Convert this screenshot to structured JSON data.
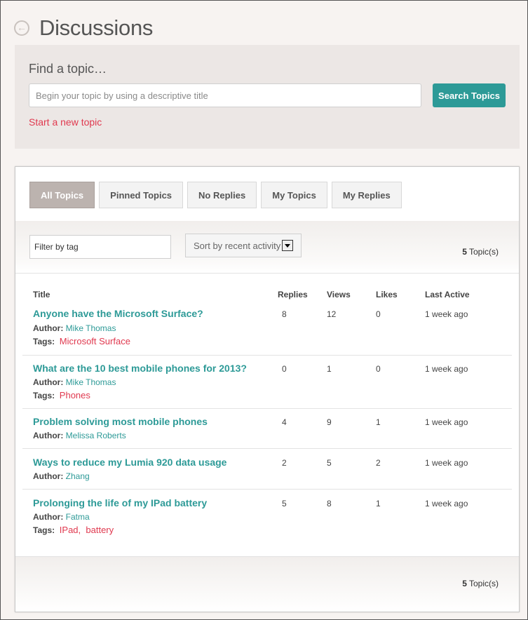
{
  "header": {
    "title": "Discussions",
    "back_icon": "arrow-left-circle-icon"
  },
  "search": {
    "label": "Find a topic…",
    "placeholder": "Begin your topic by using a descriptive title",
    "button_label": "Search Topics",
    "new_topic_label": "Start a new topic"
  },
  "tabs": [
    {
      "label": "All Topics",
      "active": true
    },
    {
      "label": "Pinned Topics",
      "active": false
    },
    {
      "label": "No Replies",
      "active": false
    },
    {
      "label": "My Topics",
      "active": false
    },
    {
      "label": "My Replies",
      "active": false
    }
  ],
  "filters": {
    "tag_placeholder": "Filter by tag",
    "sort_selected": "Sort by recent activity",
    "count_number": "5",
    "count_label": " Topic(s)"
  },
  "columns": {
    "title": "Title",
    "replies": "Replies",
    "views": "Views",
    "likes": "Likes",
    "last_active": "Last Active"
  },
  "labels": {
    "author": "Author:",
    "tags": "Tags:"
  },
  "topics": [
    {
      "title": "Anyone have the Microsoft Surface?",
      "author": "Mike Thomas",
      "tags": [
        "Microsoft Surface"
      ],
      "replies": "8",
      "views": "12",
      "likes": "0",
      "last_active": "1 week ago"
    },
    {
      "title": "What are the 10 best mobile phones for 2013?",
      "author": "Mike Thomas",
      "tags": [
        "Phones"
      ],
      "replies": "0",
      "views": "1",
      "likes": "0",
      "last_active": "1 week ago"
    },
    {
      "title": "Problem solving most mobile phones",
      "author": "Melissa Roberts",
      "tags": [],
      "replies": "4",
      "views": "9",
      "likes": "1",
      "last_active": "1 week ago"
    },
    {
      "title": "Ways to reduce my Lumia 920 data usage",
      "author": "Zhang",
      "tags": [],
      "replies": "2",
      "views": "5",
      "likes": "2",
      "last_active": "1 week ago"
    },
    {
      "title": "Prolonging the life of my IPad battery",
      "author": "Fatma",
      "tags": [
        "IPad",
        "battery"
      ],
      "replies": "5",
      "views": "8",
      "likes": "1",
      "last_active": "1 week ago"
    }
  ],
  "colors": {
    "accent": "#2d9a97",
    "link_red": "#e0394f",
    "tab_active": "#bcb3af"
  }
}
